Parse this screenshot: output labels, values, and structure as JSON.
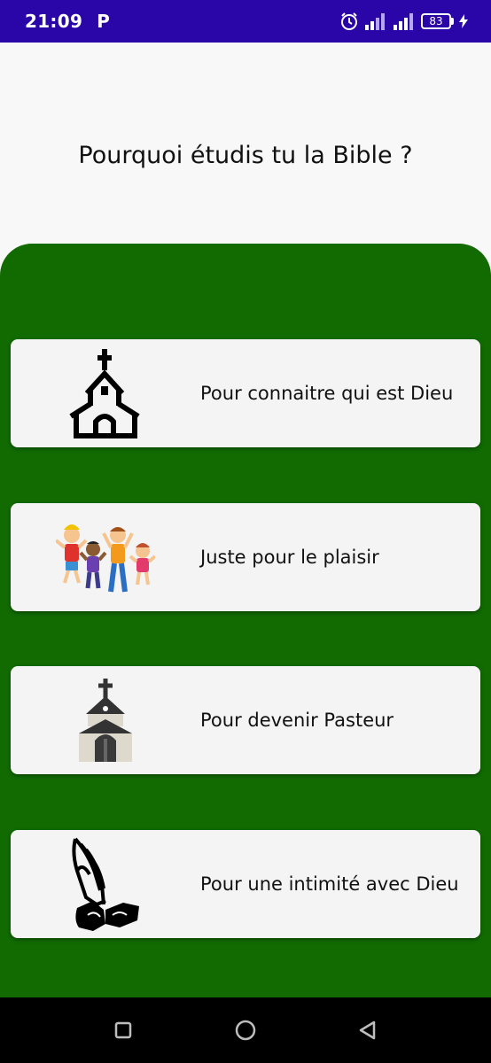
{
  "status_bar": {
    "time": "21:09",
    "notification_icon": "parking-p-icon",
    "alarm_icon": "alarm-clock-icon",
    "signal_icons": [
      "signal-bars-icon",
      "signal-bars-icon"
    ],
    "battery_level": "83",
    "charging_icon": "lightning-bolt-icon"
  },
  "colors": {
    "status_bar": "#2a06a8",
    "panel": "#116b00",
    "card": "#f5f4f5"
  },
  "screen": {
    "question": "Pourquoi étudis tu la Bible ?"
  },
  "options": [
    {
      "label": "Pour connaitre qui est Dieu",
      "icon": "church-outline-icon"
    },
    {
      "label": "Juste pour le plaisir",
      "icon": "happy-kids-icon"
    },
    {
      "label": "Pour devenir Pasteur",
      "icon": "chapel-icon"
    },
    {
      "label": "Pour une intimité avec Dieu",
      "icon": "praying-hands-icon"
    }
  ],
  "nav_bar": {
    "recent_icon": "square-recents-icon",
    "home_icon": "circle-home-icon",
    "back_icon": "triangle-back-icon"
  }
}
